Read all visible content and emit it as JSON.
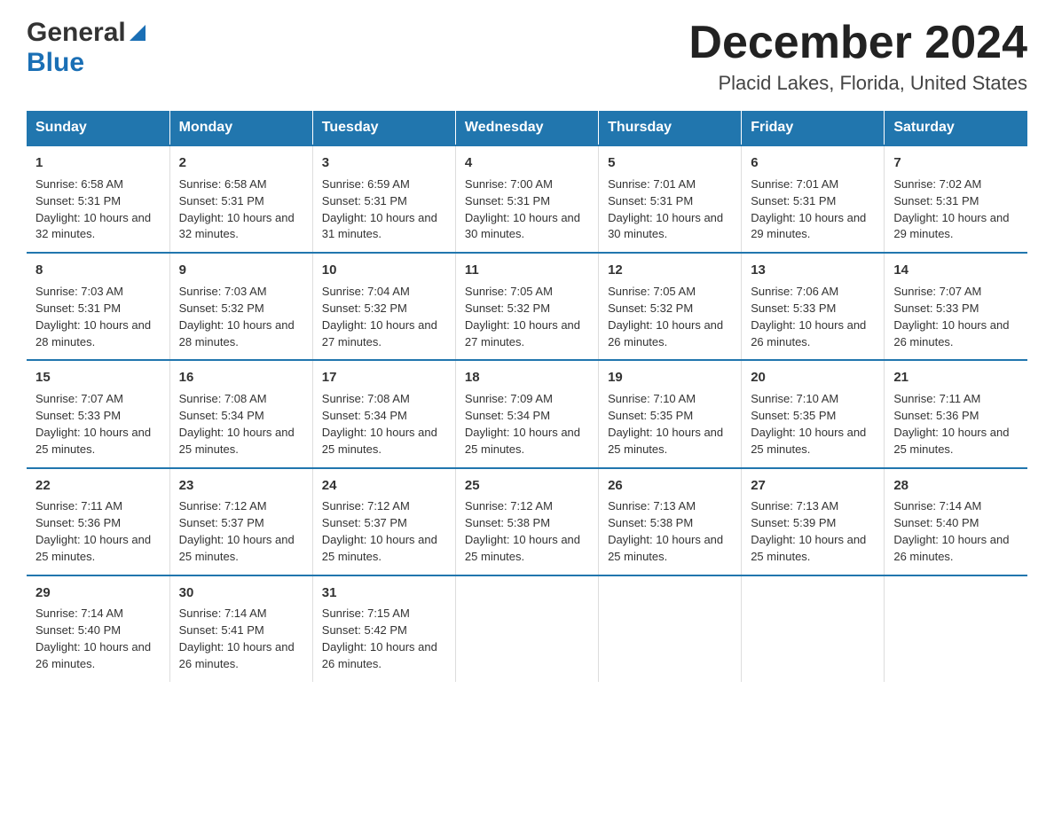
{
  "logo": {
    "general": "General",
    "blue": "Blue"
  },
  "header": {
    "month": "December 2024",
    "location": "Placid Lakes, Florida, United States"
  },
  "days_of_week": [
    "Sunday",
    "Monday",
    "Tuesday",
    "Wednesday",
    "Thursday",
    "Friday",
    "Saturday"
  ],
  "weeks": [
    [
      {
        "day": "1",
        "sunrise": "6:58 AM",
        "sunset": "5:31 PM",
        "daylight": "10 hours and 32 minutes."
      },
      {
        "day": "2",
        "sunrise": "6:58 AM",
        "sunset": "5:31 PM",
        "daylight": "10 hours and 32 minutes."
      },
      {
        "day": "3",
        "sunrise": "6:59 AM",
        "sunset": "5:31 PM",
        "daylight": "10 hours and 31 minutes."
      },
      {
        "day": "4",
        "sunrise": "7:00 AM",
        "sunset": "5:31 PM",
        "daylight": "10 hours and 30 minutes."
      },
      {
        "day": "5",
        "sunrise": "7:01 AM",
        "sunset": "5:31 PM",
        "daylight": "10 hours and 30 minutes."
      },
      {
        "day": "6",
        "sunrise": "7:01 AM",
        "sunset": "5:31 PM",
        "daylight": "10 hours and 29 minutes."
      },
      {
        "day": "7",
        "sunrise": "7:02 AM",
        "sunset": "5:31 PM",
        "daylight": "10 hours and 29 minutes."
      }
    ],
    [
      {
        "day": "8",
        "sunrise": "7:03 AM",
        "sunset": "5:31 PM",
        "daylight": "10 hours and 28 minutes."
      },
      {
        "day": "9",
        "sunrise": "7:03 AM",
        "sunset": "5:32 PM",
        "daylight": "10 hours and 28 minutes."
      },
      {
        "day": "10",
        "sunrise": "7:04 AM",
        "sunset": "5:32 PM",
        "daylight": "10 hours and 27 minutes."
      },
      {
        "day": "11",
        "sunrise": "7:05 AM",
        "sunset": "5:32 PM",
        "daylight": "10 hours and 27 minutes."
      },
      {
        "day": "12",
        "sunrise": "7:05 AM",
        "sunset": "5:32 PM",
        "daylight": "10 hours and 26 minutes."
      },
      {
        "day": "13",
        "sunrise": "7:06 AM",
        "sunset": "5:33 PM",
        "daylight": "10 hours and 26 minutes."
      },
      {
        "day": "14",
        "sunrise": "7:07 AM",
        "sunset": "5:33 PM",
        "daylight": "10 hours and 26 minutes."
      }
    ],
    [
      {
        "day": "15",
        "sunrise": "7:07 AM",
        "sunset": "5:33 PM",
        "daylight": "10 hours and 25 minutes."
      },
      {
        "day": "16",
        "sunrise": "7:08 AM",
        "sunset": "5:34 PM",
        "daylight": "10 hours and 25 minutes."
      },
      {
        "day": "17",
        "sunrise": "7:08 AM",
        "sunset": "5:34 PM",
        "daylight": "10 hours and 25 minutes."
      },
      {
        "day": "18",
        "sunrise": "7:09 AM",
        "sunset": "5:34 PM",
        "daylight": "10 hours and 25 minutes."
      },
      {
        "day": "19",
        "sunrise": "7:10 AM",
        "sunset": "5:35 PM",
        "daylight": "10 hours and 25 minutes."
      },
      {
        "day": "20",
        "sunrise": "7:10 AM",
        "sunset": "5:35 PM",
        "daylight": "10 hours and 25 minutes."
      },
      {
        "day": "21",
        "sunrise": "7:11 AM",
        "sunset": "5:36 PM",
        "daylight": "10 hours and 25 minutes."
      }
    ],
    [
      {
        "day": "22",
        "sunrise": "7:11 AM",
        "sunset": "5:36 PM",
        "daylight": "10 hours and 25 minutes."
      },
      {
        "day": "23",
        "sunrise": "7:12 AM",
        "sunset": "5:37 PM",
        "daylight": "10 hours and 25 minutes."
      },
      {
        "day": "24",
        "sunrise": "7:12 AM",
        "sunset": "5:37 PM",
        "daylight": "10 hours and 25 minutes."
      },
      {
        "day": "25",
        "sunrise": "7:12 AM",
        "sunset": "5:38 PM",
        "daylight": "10 hours and 25 minutes."
      },
      {
        "day": "26",
        "sunrise": "7:13 AM",
        "sunset": "5:38 PM",
        "daylight": "10 hours and 25 minutes."
      },
      {
        "day": "27",
        "sunrise": "7:13 AM",
        "sunset": "5:39 PM",
        "daylight": "10 hours and 25 minutes."
      },
      {
        "day": "28",
        "sunrise": "7:14 AM",
        "sunset": "5:40 PM",
        "daylight": "10 hours and 26 minutes."
      }
    ],
    [
      {
        "day": "29",
        "sunrise": "7:14 AM",
        "sunset": "5:40 PM",
        "daylight": "10 hours and 26 minutes."
      },
      {
        "day": "30",
        "sunrise": "7:14 AM",
        "sunset": "5:41 PM",
        "daylight": "10 hours and 26 minutes."
      },
      {
        "day": "31",
        "sunrise": "7:15 AM",
        "sunset": "5:42 PM",
        "daylight": "10 hours and 26 minutes."
      },
      {
        "day": "",
        "sunrise": "",
        "sunset": "",
        "daylight": ""
      },
      {
        "day": "",
        "sunrise": "",
        "sunset": "",
        "daylight": ""
      },
      {
        "day": "",
        "sunrise": "",
        "sunset": "",
        "daylight": ""
      },
      {
        "day": "",
        "sunrise": "",
        "sunset": "",
        "daylight": ""
      }
    ]
  ],
  "labels": {
    "sunrise": "Sunrise: ",
    "sunset": "Sunset: ",
    "daylight": "Daylight: "
  }
}
